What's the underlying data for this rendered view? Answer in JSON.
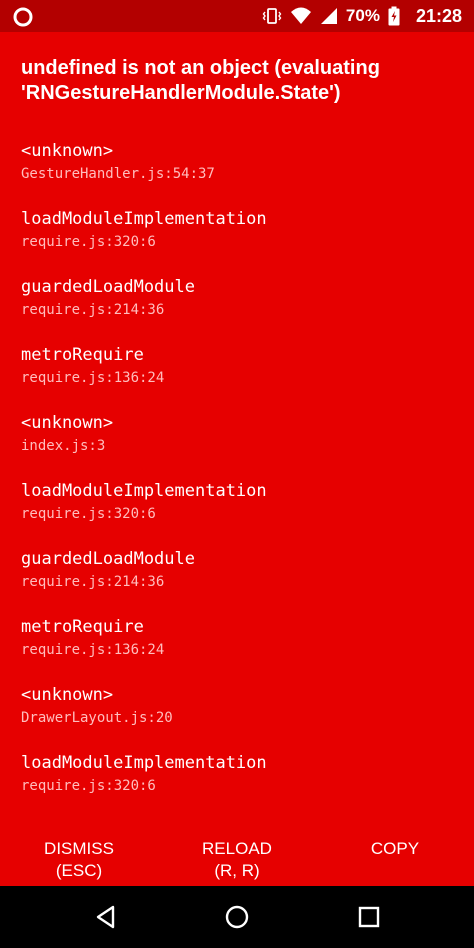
{
  "status_bar": {
    "battery_percent": "70%",
    "time": "21:28",
    "icons": [
      "app-notification-icon",
      "vibrate-icon",
      "wifi-icon",
      "cell-signal-icon",
      "battery-charging-icon"
    ]
  },
  "error": {
    "title": "undefined is not an object (evaluating 'RNGestureHandlerModule.State')"
  },
  "stack": [
    {
      "fn": "<unknown>",
      "loc": "GestureHandler.js:54:37"
    },
    {
      "fn": "loadModuleImplementation",
      "loc": "require.js:320:6"
    },
    {
      "fn": "guardedLoadModule",
      "loc": "require.js:214:36"
    },
    {
      "fn": "metroRequire",
      "loc": "require.js:136:24"
    },
    {
      "fn": "<unknown>",
      "loc": "index.js:3"
    },
    {
      "fn": "loadModuleImplementation",
      "loc": "require.js:320:6"
    },
    {
      "fn": "guardedLoadModule",
      "loc": "require.js:214:36"
    },
    {
      "fn": "metroRequire",
      "loc": "require.js:136:24"
    },
    {
      "fn": "<unknown>",
      "loc": "DrawerLayout.js:20"
    },
    {
      "fn": "loadModuleImplementation",
      "loc": "require.js:320:6"
    }
  ],
  "actions": {
    "dismiss": {
      "label": "DISMISS",
      "shortcut": "(ESC)"
    },
    "reload": {
      "label": "RELOAD",
      "shortcut": "(R, R)"
    },
    "copy": {
      "label": "COPY"
    }
  },
  "nav_bar": {
    "icons": [
      "back-icon",
      "home-icon",
      "recents-icon"
    ]
  },
  "colors": {
    "background": "#e60000",
    "status_bar": "#b30000",
    "nav_bar": "#000000",
    "text": "#ffffff",
    "location_text": "#ffbdbd"
  }
}
